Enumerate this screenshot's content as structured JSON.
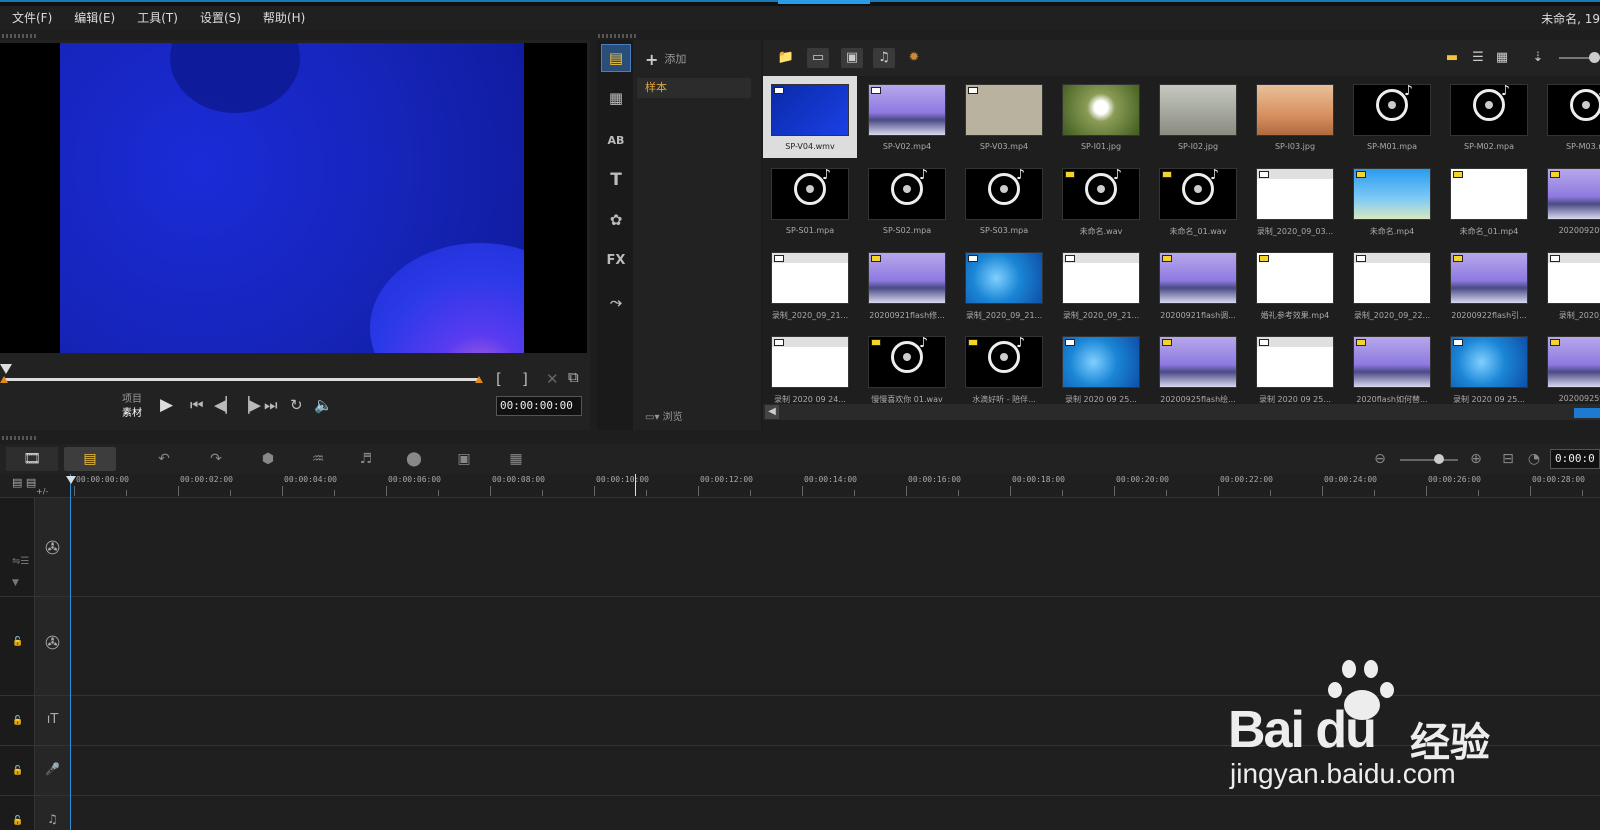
{
  "menu": [
    "文件(F)",
    "编辑(E)",
    "工具(T)",
    "设置(S)",
    "帮助(H)"
  ],
  "project_title": "未命名, 19",
  "preview": {
    "mode_labels": [
      "项目",
      "素材"
    ],
    "timecode": "00:00:00:00"
  },
  "library": {
    "add_label": "添加",
    "folder": "样本",
    "browse_label": "浏览",
    "items": [
      {
        "caption": "SP-V04.wmv",
        "kind": "wblue",
        "badge": "w",
        "selected": true
      },
      {
        "caption": "SP-V02.mp4",
        "kind": "purple",
        "badge": "w"
      },
      {
        "caption": "SP-V03.mp4",
        "kind": "beige",
        "badge": "w"
      },
      {
        "caption": "SP-I01.jpg",
        "kind": "dand",
        "badge": ""
      },
      {
        "caption": "SP-I02.jpg",
        "kind": "trees",
        "badge": ""
      },
      {
        "caption": "SP-I03.jpg",
        "kind": "desert",
        "badge": ""
      },
      {
        "caption": "SP-M01.mpa",
        "kind": "audio",
        "badge": ""
      },
      {
        "caption": "SP-M02.mpa",
        "kind": "audio",
        "badge": ""
      },
      {
        "caption": "SP-M03.m",
        "kind": "audio",
        "badge": ""
      },
      {
        "caption": "SP-S01.mpa",
        "kind": "audio",
        "badge": ""
      },
      {
        "caption": "SP-S02.mpa",
        "kind": "audio",
        "badge": ""
      },
      {
        "caption": "SP-S03.mpa",
        "kind": "audio",
        "badge": ""
      },
      {
        "caption": "未命名.wav",
        "kind": "audio",
        "badge": "y"
      },
      {
        "caption": "未命名_01.wav",
        "kind": "audio",
        "badge": "y"
      },
      {
        "caption": "录制_2020_09_03...",
        "kind": "shot",
        "badge": "w"
      },
      {
        "caption": "未命名.mp4",
        "kind": "sky",
        "badge": "y"
      },
      {
        "caption": "未命名_01.mp4",
        "kind": "white",
        "badge": "y"
      },
      {
        "caption": "20200920flas",
        "kind": "purple",
        "badge": "y"
      },
      {
        "caption": "录制_2020_09_21...",
        "kind": "shot",
        "badge": "w"
      },
      {
        "caption": "20200921flash修...",
        "kind": "purple",
        "badge": "y"
      },
      {
        "caption": "录制_2020_09_21...",
        "kind": "win7",
        "badge": "w"
      },
      {
        "caption": "录制_2020_09_21...",
        "kind": "shot",
        "badge": "w"
      },
      {
        "caption": "20200921flash调...",
        "kind": "purple",
        "badge": "y"
      },
      {
        "caption": "婚礼参考效果.mp4",
        "kind": "white",
        "badge": "y"
      },
      {
        "caption": "录制_2020_09_22...",
        "kind": "shot",
        "badge": "w"
      },
      {
        "caption": "20200922flash引...",
        "kind": "purple",
        "badge": "y"
      },
      {
        "caption": "录制_2020_09",
        "kind": "shot",
        "badge": "w"
      },
      {
        "caption": "录制 2020 09 24...",
        "kind": "shot",
        "badge": "w"
      },
      {
        "caption": "慢慢喜欢你 01.wav",
        "kind": "audio",
        "badge": "y"
      },
      {
        "caption": "水滴好听 - 陪伴...",
        "kind": "audio",
        "badge": "y"
      },
      {
        "caption": "录制 2020 09 25...",
        "kind": "win7",
        "badge": "w"
      },
      {
        "caption": "20200925flash绘...",
        "kind": "purple",
        "badge": "y"
      },
      {
        "caption": "录制 2020 09 25...",
        "kind": "shot",
        "badge": "w"
      },
      {
        "caption": "2020flash如何替...",
        "kind": "purple",
        "badge": "y"
      },
      {
        "caption": "录制 2020 09 25...",
        "kind": "win7",
        "badge": "w"
      },
      {
        "caption": "20200925flas",
        "kind": "purple",
        "badge": "y"
      }
    ]
  },
  "timeline": {
    "timecode": "0:00:0",
    "ruler_labels": [
      "00:00:00:00",
      "00:00:02:00",
      "00:00:04:00",
      "00:00:06:00",
      "00:00:08:00",
      "00:00:10:00",
      "00:00:12:00",
      "00:00:14:00",
      "00:00:16:00",
      "00:00:18:00",
      "00:00:20:00",
      "00:00:22:00",
      "00:00:24:00",
      "00:00:26:00",
      "00:00:28:00"
    ],
    "track_label": "+/-"
  },
  "watermark": {
    "brand": "Bai du",
    "suffix": "经验",
    "url": "jingyan.baidu.com"
  }
}
